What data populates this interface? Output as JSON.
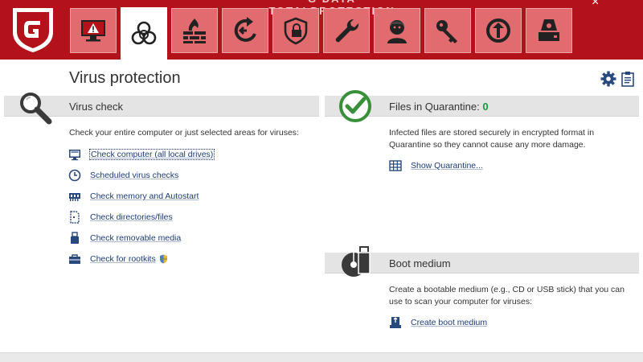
{
  "window": {
    "title": "G DATA TOTALPROTECTION",
    "close_symbol": "×"
  },
  "colors": {
    "brand_red": "#b4121a",
    "tab_pink": "#e26b6f",
    "link_blue": "#1b3c78",
    "success_green": "#18983c"
  },
  "tabs": [
    {
      "name": "security-center",
      "icon": "monitor-warning-icon",
      "active": false
    },
    {
      "name": "virus-protection",
      "icon": "biohazard-icon",
      "active": true
    },
    {
      "name": "firewall",
      "icon": "brick-wall-flame-icon",
      "active": false
    },
    {
      "name": "backup",
      "icon": "backup-arrow-icon",
      "active": false
    },
    {
      "name": "encryption",
      "icon": "shield-lock-icon",
      "active": false
    },
    {
      "name": "tuner",
      "icon": "wrench-icon",
      "active": false
    },
    {
      "name": "parental-controls",
      "icon": "child-face-icon",
      "active": false
    },
    {
      "name": "password-manager",
      "icon": "key-icon",
      "active": false
    },
    {
      "name": "autostart-manager",
      "icon": "power-arrow-icon",
      "active": false
    },
    {
      "name": "device-control",
      "icon": "drive-icon",
      "active": false
    }
  ],
  "page": {
    "title": "Virus protection"
  },
  "virus_check": {
    "heading": "Virus check",
    "description": "Check your entire computer or just selected areas for viruses:",
    "links": [
      {
        "label": "Check computer (all local drives)",
        "icon": "monitor-icon"
      },
      {
        "label": "Scheduled virus checks",
        "icon": "clock-icon"
      },
      {
        "label": "Check memory and Autostart",
        "icon": "memory-chip-icon"
      },
      {
        "label": "Check directories/files",
        "icon": "file-icon"
      },
      {
        "label": "Check removable media",
        "icon": "usb-stick-icon"
      },
      {
        "label": "Check for rootkits",
        "icon": "toolbox-icon"
      }
    ]
  },
  "quarantine": {
    "heading": "Files in Quarantine: ",
    "count": "0",
    "description_line1": "Infected files are stored securely in encrypted format in",
    "description_line2": "Quarantine so they cannot cause any more damage.",
    "link": "Show Quarantine..."
  },
  "boot_medium": {
    "heading": "Boot medium",
    "description_line1": "Create a bootable medium (e.g., CD or USB stick) that you can",
    "description_line2": "use to scan your computer for viruses:",
    "link": "Create boot medium"
  }
}
